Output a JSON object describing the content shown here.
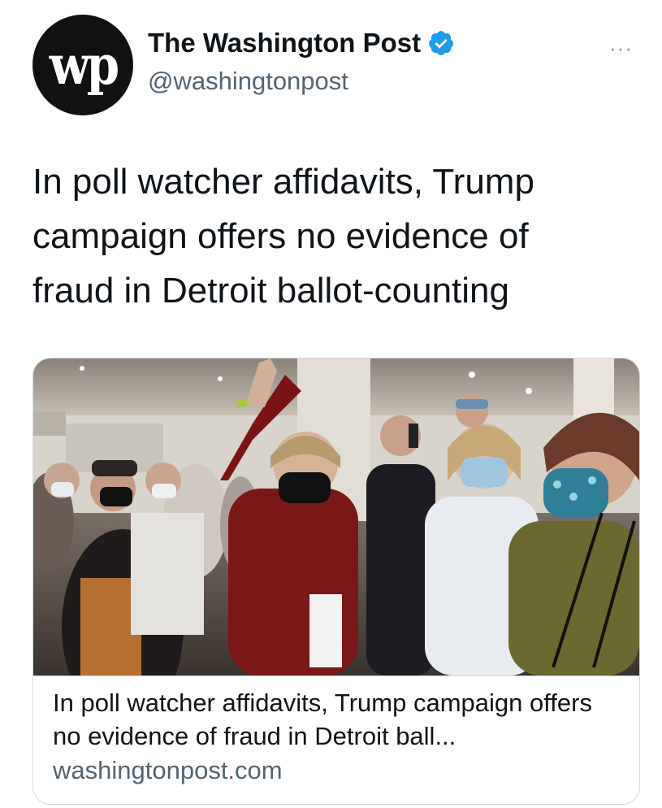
{
  "author": {
    "avatar_text": "wp",
    "display_name": "The Washington Post",
    "handle": "@washingtonpost",
    "verified": true
  },
  "more_icon": "···",
  "tweet": {
    "text_lines": [
      "In poll watcher affidavits, Trump",
      "campaign offers no evidence of",
      "fraud in Detroit ballot-counting"
    ]
  },
  "card": {
    "image_alt": "Crowd of poll watchers wearing masks in a convention hall",
    "title": "In poll watcher affidavits, Trump campaign offers no evidence of fraud in Detroit ball...",
    "domain": "washingtonpost.com"
  },
  "colors": {
    "verified_blue": "#1d9bf0",
    "muted_text": "#536471",
    "border": "#cfd9de"
  }
}
